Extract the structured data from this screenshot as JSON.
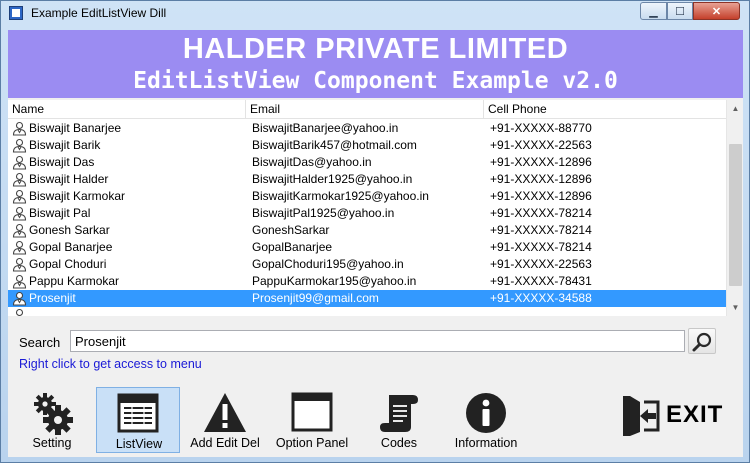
{
  "window": {
    "title": "Example EditListView Dill"
  },
  "banner": {
    "title": "HALDER PRIVATE LIMITED",
    "subtitle": "EditListView Component Example v2.0"
  },
  "columns": {
    "name": "Name",
    "email": "Email",
    "phone": "Cell Phone"
  },
  "rows": [
    {
      "name": "Biswajit Banarjee",
      "email": "BiswajitBanarjee@yahoo.in",
      "phone": "+91-XXXXX-88770"
    },
    {
      "name": "Biswajit Barik",
      "email": "BiswajitBarik457@hotmail.com",
      "phone": "+91-XXXXX-22563"
    },
    {
      "name": "Biswajit Das",
      "email": "BiswajitDas@yahoo.in",
      "phone": "+91-XXXXX-12896"
    },
    {
      "name": "Biswajit Halder",
      "email": "BiswajitHalder1925@yahoo.in",
      "phone": "+91-XXXXX-12896"
    },
    {
      "name": "Biswajit Karmokar",
      "email": "BiswajitKarmokar1925@yahoo.in",
      "phone": "+91-XXXXX-12896"
    },
    {
      "name": "Biswajit Pal",
      "email": "BiswajitPal1925@yahoo.in",
      "phone": "+91-XXXXX-78214"
    },
    {
      "name": "Gonesh Sarkar",
      "email": "GoneshSarkar",
      "phone": "+91-XXXXX-78214"
    },
    {
      "name": "Gopal Banarjee",
      "email": "GopalBanarjee",
      "phone": "+91-XXXXX-78214"
    },
    {
      "name": "Gopal Choduri",
      "email": "GopalChoduri195@yahoo.in",
      "phone": "+91-XXXXX-22563"
    },
    {
      "name": "Pappu Karmokar",
      "email": "PappuKarmokar195@yahoo.in",
      "phone": "+91-XXXXX-78431"
    },
    {
      "name": "Prosenjit",
      "email": "Prosenjit99@gmail.com",
      "phone": "+91-XXXXX-34588",
      "selected": true
    }
  ],
  "search": {
    "label": "Search",
    "value": "Prosenjit"
  },
  "hint": "Right click to get access to menu",
  "toolbar": {
    "setting": "Setting",
    "listview": "ListView",
    "add_edit_del": "Add Edit Del",
    "option_panel": "Option Panel",
    "codes": "Codes",
    "information": "Information",
    "exit": "EXIT"
  },
  "colors": {
    "banner": "#9b8cf2",
    "selection": "#3399ff",
    "hint": "#1a1ad6"
  }
}
